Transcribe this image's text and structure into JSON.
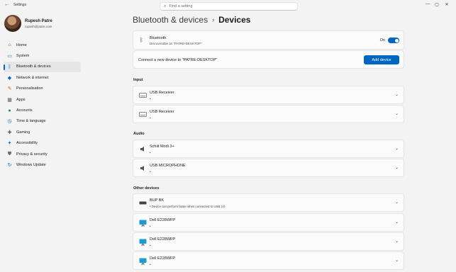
{
  "window": {
    "title": "Settings",
    "search_placeholder": "Find a setting",
    "back_glyph": "←",
    "minimize_glyph": "—",
    "maximize_glyph": "▢",
    "close_glyph": "✕"
  },
  "profile": {
    "name": "Rupesh Patre",
    "email": "rupesh@patre.com"
  },
  "sidebar": {
    "items": [
      {
        "label": "Home",
        "icon": "home-icon",
        "glyph": "⌂",
        "color": "#555555"
      },
      {
        "label": "System",
        "icon": "system-icon",
        "glyph": "▭",
        "color": "#0078d4"
      },
      {
        "label": "Bluetooth & devices",
        "icon": "bluetooth-icon",
        "glyph": "ᛒ",
        "color": "#0078d4"
      },
      {
        "label": "Network & internet",
        "icon": "network-icon",
        "glyph": "◆",
        "color": "#0067c0"
      },
      {
        "label": "Personalisation",
        "icon": "brush-icon",
        "glyph": "✎",
        "color": "#c26a14"
      },
      {
        "label": "Apps",
        "icon": "apps-icon",
        "glyph": "▦",
        "color": "#5a5a5a"
      },
      {
        "label": "Accounts",
        "icon": "accounts-icon",
        "glyph": "●",
        "color": "#1b8a3a"
      },
      {
        "label": "Time & language",
        "icon": "globe-clock-icon",
        "glyph": "◷",
        "color": "#0067c0"
      },
      {
        "label": "Gaming",
        "icon": "gamepad-icon",
        "glyph": "✚",
        "color": "#5a5a5a"
      },
      {
        "label": "Accessibility",
        "icon": "accessibility-icon",
        "glyph": "✦",
        "color": "#0067c0"
      },
      {
        "label": "Privacy & security",
        "icon": "shield-icon",
        "glyph": "⛊",
        "color": "#6b6b6b"
      },
      {
        "label": "Windows Update",
        "icon": "update-icon",
        "glyph": "↻",
        "color": "#0067c0"
      }
    ],
    "active_index": 2
  },
  "header": {
    "parent": "Bluetooth & devices",
    "separator": "›",
    "current": "Devices"
  },
  "bluetooth": {
    "title": "Bluetooth",
    "subtitle": "Discoverable as \"PATRE-DESKTOP\"",
    "toggle_label": "On",
    "toggle_on": true,
    "accent": "#0067c0"
  },
  "connect": {
    "text": "Connect a new device to \"PATRE-DESKTOP\"",
    "button": "Add device"
  },
  "sections": {
    "input": {
      "title": "Input",
      "devices": [
        {
          "name": "USB Receiver",
          "status": "•",
          "icon": "keyboard-icon"
        },
        {
          "name": "USB Receiver",
          "status": "•",
          "icon": "keyboard-icon"
        }
      ]
    },
    "audio": {
      "title": "Audio",
      "devices": [
        {
          "name": "Schiit Modi 3+",
          "status": "•",
          "icon": "speaker-icon"
        },
        {
          "name": "USB MICROPHONE",
          "status": "•",
          "icon": "speaker-icon"
        }
      ]
    },
    "other": {
      "title": "Other devices",
      "devices": [
        {
          "name": "BUP BK",
          "status": "• Device can perform faster when connected to USB 3.0",
          "icon": "drive-icon"
        },
        {
          "name": "Dell E228WFP",
          "status": "•",
          "icon": "monitor-icon"
        },
        {
          "name": "Dell E228WFP",
          "status": "•",
          "icon": "monitor-icon"
        },
        {
          "name": "Dell E228WFP",
          "status": "•",
          "icon": "monitor-icon"
        }
      ]
    }
  },
  "chevron_glyph": "⌄"
}
